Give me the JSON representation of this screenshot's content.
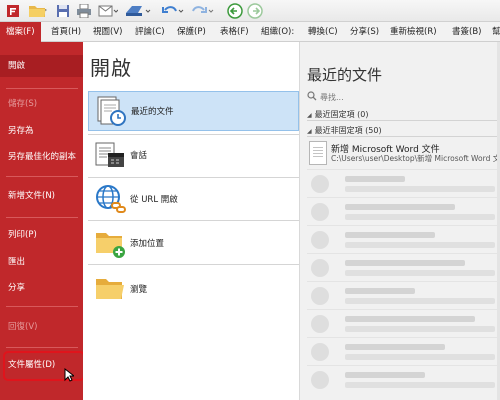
{
  "menu": {
    "tabs": [
      "檔案(F)",
      "首頁(H)",
      "視圖(V)",
      "評論(C)",
      "保護(P)",
      "表格(F)",
      "組織(O):",
      "轉換(C)",
      "分享(S)",
      "重新檢視(R)",
      "書簽(B)",
      "幫"
    ],
    "active_index": 0
  },
  "sidebar": {
    "items": [
      {
        "label": "開啟",
        "state": "selected"
      },
      {
        "label": "儲存(S)",
        "state": "disabled"
      },
      {
        "label": "另存為",
        "state": "normal"
      },
      {
        "label": "另存最佳化的副本",
        "state": "normal"
      },
      {
        "label": "新增文件(N)",
        "state": "normal"
      },
      {
        "label": "列印(P)",
        "state": "normal"
      },
      {
        "label": "匯出",
        "state": "normal"
      },
      {
        "label": "分享",
        "state": "normal"
      },
      {
        "label": "回復(V)",
        "state": "disabled"
      },
      {
        "label": "文件屬性(D)",
        "state": "highlighted"
      }
    ]
  },
  "open_pane": {
    "title": "開啟",
    "items": [
      {
        "label": "最近的文件",
        "icon": "recent-documents-icon",
        "active": true
      },
      {
        "label": "會話",
        "icon": "session-icon",
        "active": false
      },
      {
        "label": "從 URL 開啟",
        "icon": "globe-link-icon",
        "active": false
      },
      {
        "label": "添加位置",
        "icon": "add-folder-icon",
        "active": false
      },
      {
        "label": "瀏覽",
        "icon": "folder-icon",
        "active": false
      }
    ]
  },
  "recent_pane": {
    "title": "最近的文件",
    "search_placeholder": "尋找...",
    "pinned_header": "最近固定項 (0)",
    "unpinned_header": "最近非固定項 (50)",
    "first_file": {
      "name": "新增 Microsoft Word 文件",
      "path": "C:\\Users\\user\\Desktop\\新增 Microsoft Word 文件"
    }
  },
  "colors": {
    "accent": "#c0282b",
    "highlight_border": "#e0141c",
    "active_item_bg": "#cde3f7"
  }
}
